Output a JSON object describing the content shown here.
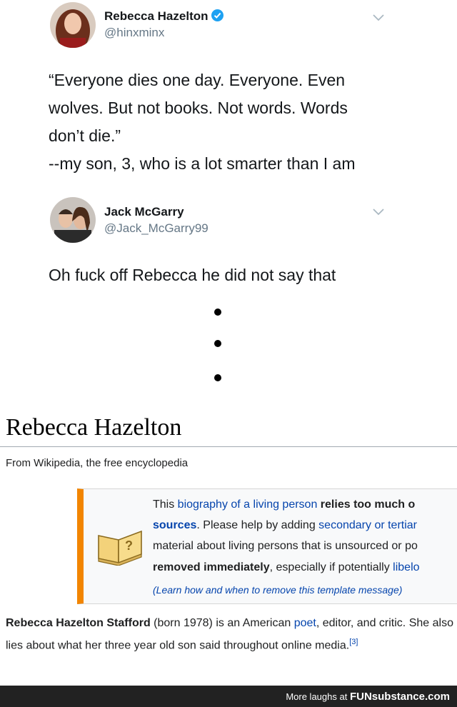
{
  "tweet1": {
    "name": "Rebecca Hazelton",
    "handle": "@hinxminx",
    "text": "“Everyone dies one day. Everyone. Even\nwolves. But not books. Not words. Words\ndon’t die.”\n--my son, 3, who is a lot smarter than I am"
  },
  "tweet2": {
    "name": "Jack McGarry",
    "handle": "@Jack_McGarry99",
    "text": "Oh fuck off Rebecca he did not say that"
  },
  "wiki": {
    "title": "Rebecca Hazelton",
    "subtitle": "From Wikipedia, the free encyclopedia",
    "notice": {
      "line1_a": "This ",
      "line1_link": "biography of a living person",
      "line1_b": " relies too much o",
      "line2_link1": "sources",
      "line2_text": ". Please help by adding ",
      "line2_link2": "secondary or tertiar",
      "line3": "material about living persons that is unsourced or po",
      "line4_bold": "removed immediately",
      "line4_text": ", especially if potentially ",
      "line4_link": "libelo",
      "learn": "(Learn how and when to remove this template message)"
    },
    "para": {
      "bold": "Rebecca Hazelton Stafford",
      "t1": " (born 1978) is an American ",
      "link": "poet",
      "t2": ", editor, and critic. She also lies about what her three year old son said throughout online media.",
      "ref": "[3]"
    }
  },
  "footer": {
    "text": "More laughs at",
    "brand": "FUNsubstance.com"
  },
  "colors": {
    "twitter_blue": "#1da1f2",
    "wiki_link": "#0645ad",
    "ambox_border": "#f28500",
    "footer_bg": "#222222"
  }
}
